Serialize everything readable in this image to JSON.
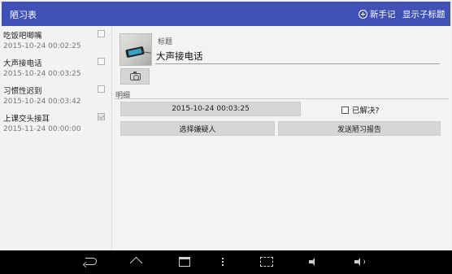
{
  "app": {
    "title": "陋习表",
    "actions": {
      "new_note": "新手记",
      "show_subtitle": "显示子标题"
    }
  },
  "list": {
    "items": [
      {
        "title": "吃饭吧唧嘴",
        "date": "2015-10-24 00:02:25",
        "solved": false
      },
      {
        "title": "大声接电话",
        "date": "2015-10-24 00:03:25",
        "solved": false
      },
      {
        "title": "习惯性迟到",
        "date": "2015-10-24 00:03:42",
        "solved": false
      },
      {
        "title": "上课交头接耳",
        "date": "2015-11-24 00:00:00",
        "solved": true
      }
    ]
  },
  "detail": {
    "title_label": "标题",
    "title_value": "大声接电话",
    "details_label": "明细",
    "date_button": "2015-10-24 00:03:25",
    "solved_label": "已解决?",
    "solved": false,
    "choose_suspect": "选择嫌疑人",
    "send_report": "发送陋习报告"
  },
  "icons": {
    "add": "plus-circle-icon",
    "camera": "camera-icon",
    "nav_back": "back-icon",
    "nav_home": "home-icon",
    "nav_recents": "recents-icon",
    "nav_menu": "menu-icon",
    "nav_screenshot": "screenshot-icon",
    "nav_volume_down": "volume-down-icon",
    "nav_volume_up": "volume-up-icon"
  },
  "colors": {
    "app_bar": "#3f51b5",
    "nav_bar": "#000000"
  }
}
